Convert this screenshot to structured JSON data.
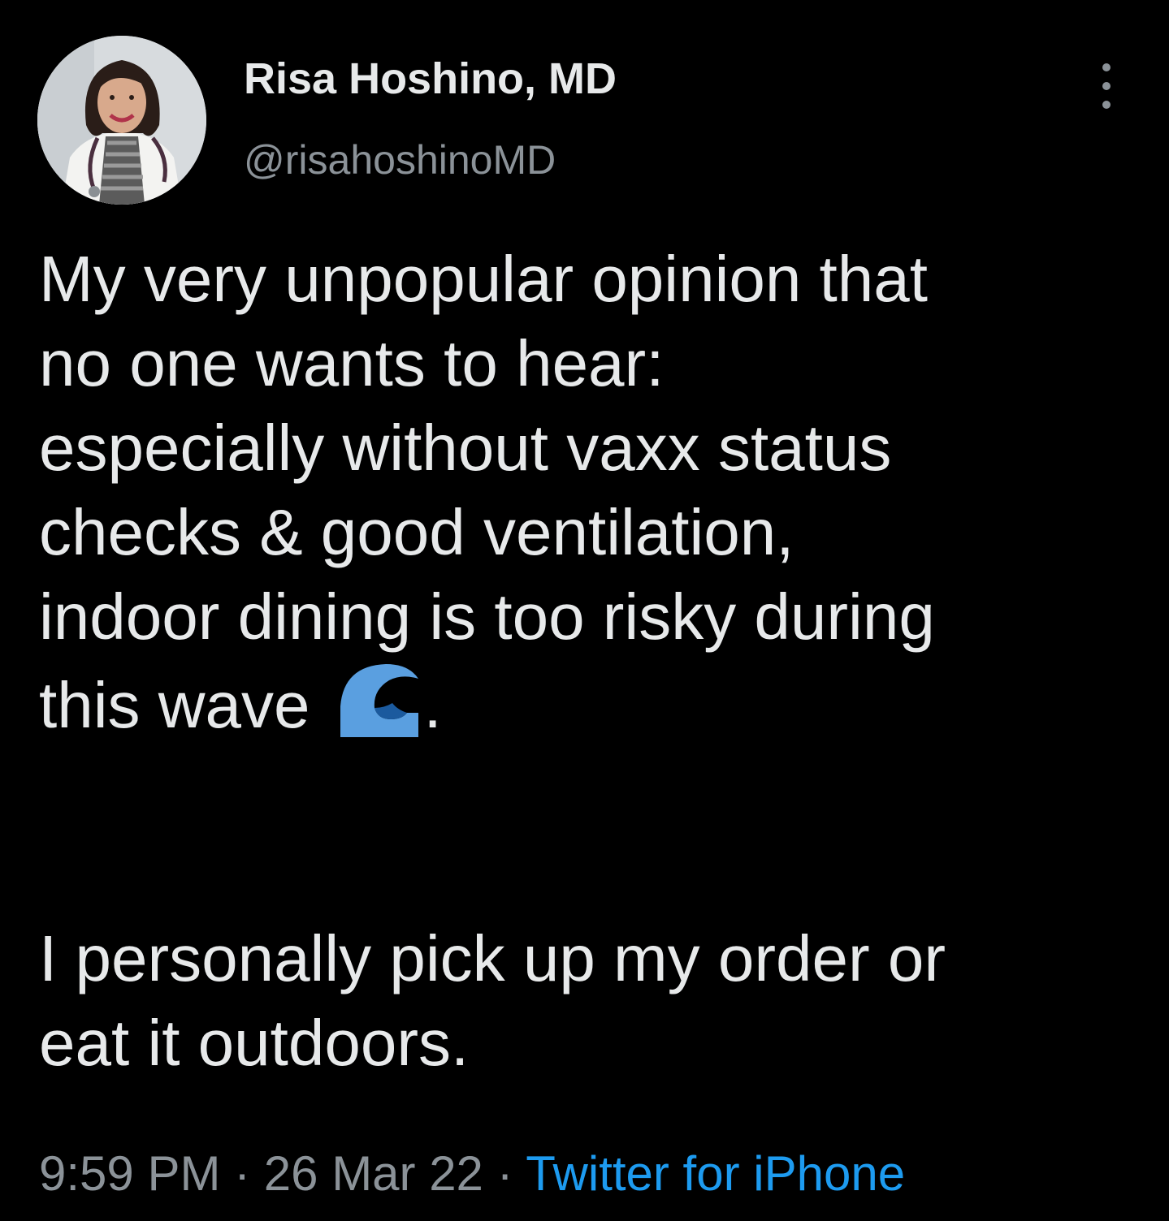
{
  "author": {
    "display_name": "Risa Hoshino, MD",
    "handle": "@risahoshinoMD"
  },
  "tweet": {
    "lines": [
      "My very unpopular opinion that",
      "no one wants to hear:",
      "especially without vaxx status",
      "checks & good ventilation,",
      "indoor dining is too risky during",
      "this wave",
      "I personally pick up my order or",
      "eat it outdoors."
    ],
    "emoji": "water-wave-icon",
    "after_emoji": "."
  },
  "meta": {
    "time": "9:59 PM",
    "separator": " · ",
    "date": "26 Mar 22",
    "source": "Twitter for iPhone"
  },
  "colors": {
    "background": "#000000",
    "text": "#e7e9ea",
    "secondary": "#8b9298",
    "link": "#1d9bf0",
    "wave": "#5a9fe0"
  }
}
